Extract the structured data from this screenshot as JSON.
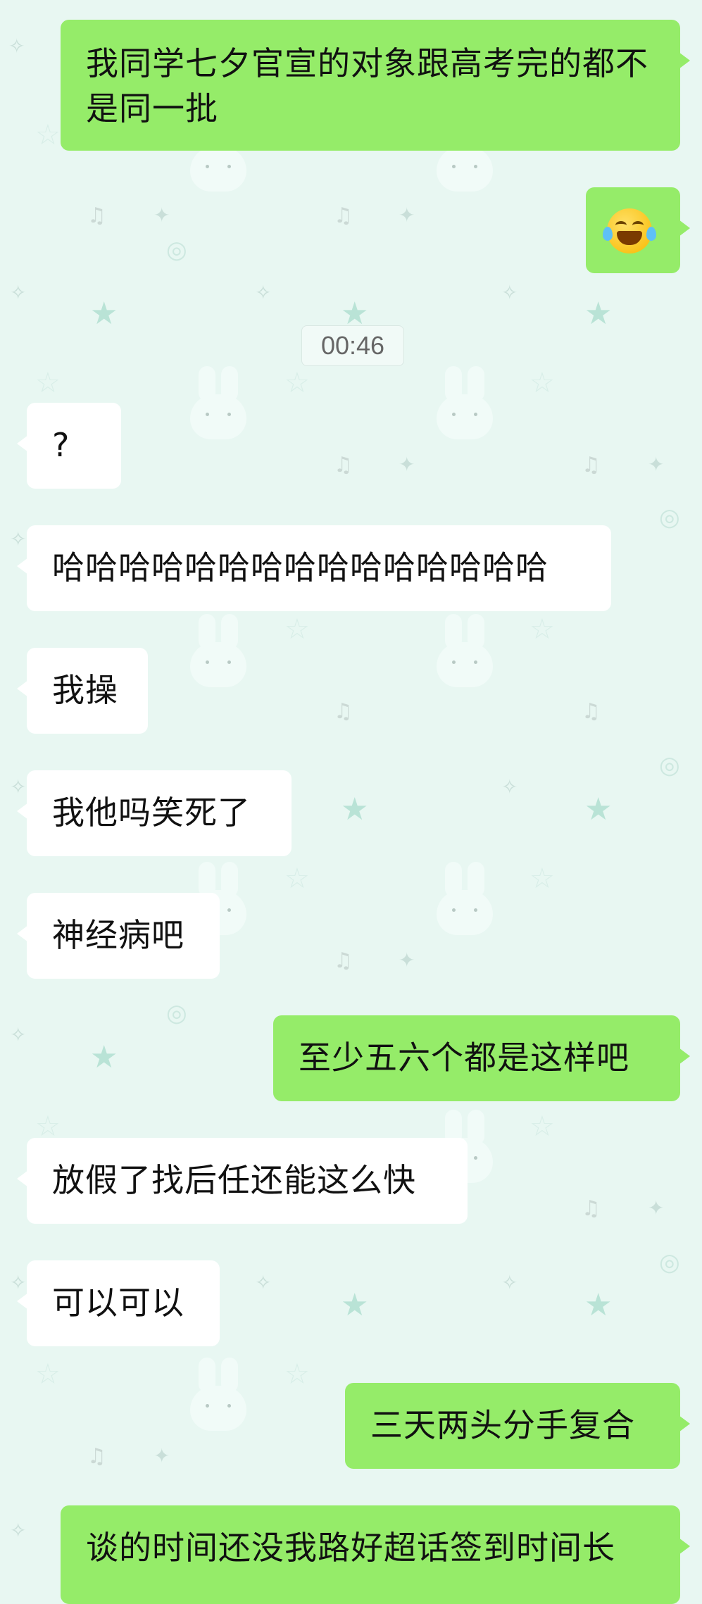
{
  "theme": {
    "sent_bubble_color": "#95ec69",
    "received_bubble_color": "#ffffff",
    "background_color": "#e8f7f2"
  },
  "timestamp": "00:46",
  "messages": [
    {
      "id": "m1",
      "side": "sent",
      "text": "我同学七夕官宣的对象跟高考完的都不是同一批"
    },
    {
      "id": "m2",
      "side": "sent",
      "type": "emoji",
      "emoji_name": "face-with-tears-of-joy-icon"
    },
    {
      "id": "m3",
      "side": "received",
      "text": "?"
    },
    {
      "id": "m4",
      "side": "received",
      "text": "哈哈哈哈哈哈哈哈哈哈哈哈哈哈哈"
    },
    {
      "id": "m5",
      "side": "received",
      "text": "我操"
    },
    {
      "id": "m6",
      "side": "received",
      "text": "我他吗笑死了"
    },
    {
      "id": "m7",
      "side": "received",
      "text": "神经病吧"
    },
    {
      "id": "m8",
      "side": "sent",
      "text": "至少五六个都是这样吧"
    },
    {
      "id": "m9",
      "side": "received",
      "text": "放假了找后任还能这么快"
    },
    {
      "id": "m10",
      "side": "received",
      "text": "可以可以"
    },
    {
      "id": "m11",
      "side": "sent",
      "text": "三天两头分手复合"
    },
    {
      "id": "m12",
      "side": "sent",
      "text": "谈的时间还没我路好超话签到时间长"
    }
  ]
}
